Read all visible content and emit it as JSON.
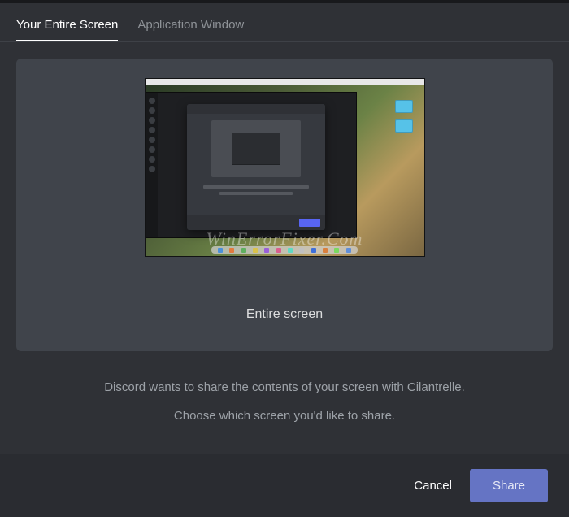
{
  "tabs": {
    "entire_screen": "Your Entire Screen",
    "app_window": "Application Window"
  },
  "card": {
    "label": "Entire screen"
  },
  "info": {
    "line1": "Discord wants to share the contents of your screen with Cilantrelle.",
    "line2": "Choose which screen you'd like to share."
  },
  "footer": {
    "cancel": "Cancel",
    "share": "Share"
  },
  "watermark": "WinErrorFixer.Com"
}
